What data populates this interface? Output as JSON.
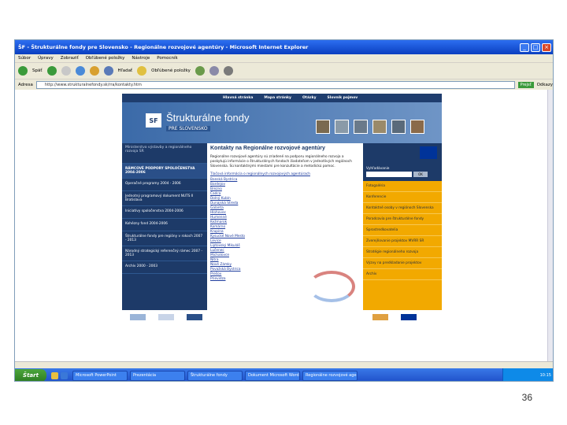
{
  "window": {
    "title": "ŠF - Štrukturálne fondy pre Slovensko - Regionálne rozvojové agentúry - Microsoft Internet Explorer"
  },
  "menu": [
    "Súbor",
    "Úpravy",
    "Zobraziť",
    "Obľúbené položky",
    "Nástroje",
    "Pomocník"
  ],
  "toolbar": {
    "back_label": "Späť",
    "search_label": "Hľadať",
    "favorites_label": "Obľúbené položky"
  },
  "address": {
    "label": "Adresa",
    "url": "http://www.strukturalnefondy.sk/rra/kontakty.htm",
    "go_label": "Prejsť",
    "links_label": "Odkazy"
  },
  "site": {
    "nav": [
      "Hlavná stránka",
      "Mapa stránky",
      "Otázky",
      "Slovník pojmov"
    ],
    "banner_title": "Štrukturálne fondy",
    "banner_sub": "PRE SLOVENSKO",
    "left_head": "Ministerstvo výstavby a regionálneho rozvoja SR",
    "left_items": [
      "RÁMCOVÉ PODPORY SPOLOČENSTVA 2004-2006",
      "Operačné programy 2004 - 2006",
      "Jednotný programový dokument NUTS II Bratislava",
      "Iniciatívy spoločenstva 2004-2006",
      "Kohézny fond 2004-2006",
      "Štrukturálne fondy pre regióny v rokoch 2007 - 2013",
      "Národný strategický referenčný rámec 2007 - 2013",
      "Archív 2000 - 2003"
    ],
    "center_title": "Kontakty na Regionálne rozvojové agentúry",
    "center_text": "Regionálne rozvojové agentúry sú zriadené na podporu regionálneho rozvoja a poskytujú informácie o štrukturálnych fondoch žiadateľom v jednotlivých regiónoch Slovenska. Sú kontaktnými miestami pre konzultácie a metodickú pomoc.",
    "center_link": "Tlačová informácia o regionálnych rozvojových agentúrach",
    "rra_list": [
      "Banská Bystrica",
      "Bardejov",
      "Brezno",
      "Čadca",
      "Dolný Kubín",
      "Dunajská Streda",
      "Galanta",
      "Hlohovec",
      "Humenné",
      "Kežmarok",
      "Komárno",
      "Krupina",
      "Kysucké Nové Mesto",
      "Levice",
      "Liptovský Mikuláš",
      "Lučenec",
      "Michalovce",
      "Nitra",
      "Nové Zámky",
      "Považská Bystrica",
      "Prešov",
      "Prievidza"
    ],
    "right_search_label": "Vyhľadávanie",
    "right_go": "OK",
    "right_items": [
      "Fotogaléria",
      "Konferencie",
      "Kontaktné osoby v regiónoch Slovenska",
      "Poradcovia pre štrukturálne fondy",
      "Sprostredkovatelia",
      "Zverejňovanie projektov MVRR SR",
      "Stratégie regionálneho rozvoja",
      "Výzvy na predkladanie projektov",
      "Archív"
    ]
  },
  "taskbar": {
    "start_label": "Štart",
    "tasks": [
      "Microsoft PowerPoint",
      "Prezentácia",
      "Štrukturálne fondy",
      "Dokument Microsoft Word",
      "Regionálne rozvojové agentúry"
    ],
    "clock": "10:15"
  },
  "slide_number": "36"
}
